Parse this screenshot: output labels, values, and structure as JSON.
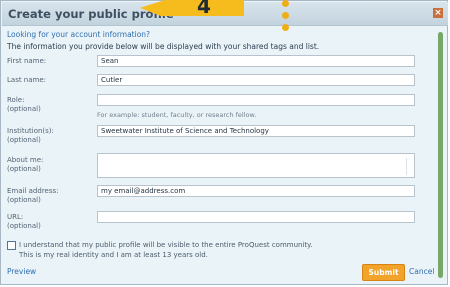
{
  "dialog": {
    "title": "Create your public profile",
    "close": "×",
    "account_link": "Looking for your account information?",
    "info": "The information you provide below will be displayed with your shared tags and list."
  },
  "annotation": {
    "number": "4"
  },
  "fields": {
    "first_name": {
      "label": "First name:",
      "value": "Sean"
    },
    "last_name": {
      "label": "Last name:",
      "value": "Cutler"
    },
    "role": {
      "label": "Role:",
      "optional": "(optional)",
      "value": "",
      "hint": "For example: student, faculty, or research fellow."
    },
    "institution": {
      "label": "Institution(s):",
      "optional": "(optional)",
      "value": "Sweetwater Institute of Science and Technology"
    },
    "about": {
      "label": "About me:",
      "optional": "(optional)",
      "value": ""
    },
    "email": {
      "label": "Email address:",
      "optional": "(optional)",
      "value": "my email@address.com"
    },
    "url": {
      "label": "URL:",
      "optional": "(optional)",
      "value": ""
    }
  },
  "terms": {
    "line1": "I understand that my public profile will be visible to the entire ProQuest community.",
    "line2": "This is my real identity and I am at least 13 years old."
  },
  "actions": {
    "preview": "Preview",
    "submit": "Submit",
    "cancel": "Cancel"
  }
}
